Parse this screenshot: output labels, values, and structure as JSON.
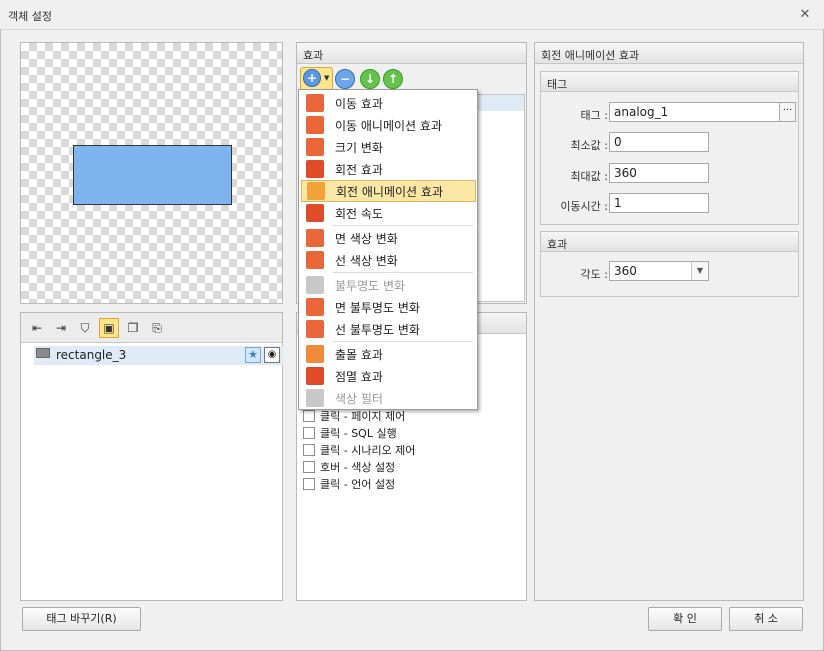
{
  "window": {
    "title": "객체 설정",
    "close_glyph": "✕"
  },
  "object_list": {
    "items": [
      {
        "name": "rectangle_3"
      }
    ]
  },
  "effect_panel": {
    "title": "효과"
  },
  "effect_menu": {
    "items": [
      {
        "label": "이동 효과",
        "icon": "move-effect-icon",
        "color": "#e8663a",
        "disabled": false
      },
      {
        "label": "이동 애니메이션 효과",
        "icon": "move-animation-icon",
        "color": "#e8663a",
        "disabled": false
      },
      {
        "label": "크기 변화",
        "icon": "resize-icon",
        "color": "#e8663a",
        "disabled": false
      },
      {
        "label": "회전 효과",
        "icon": "rotate-icon",
        "color": "#e04b2a",
        "disabled": false
      },
      {
        "label": "회전 애니메이션 효과",
        "icon": "rotate-animation-icon",
        "color": "#f3a13b",
        "disabled": false,
        "highlighted": true
      },
      {
        "label": "회전 속도",
        "icon": "rotate-speed-icon",
        "color": "#e04b2a",
        "disabled": false
      },
      {
        "label": "면 색상 변화",
        "icon": "fill-color-icon",
        "color": "#e8663a",
        "disabled": false
      },
      {
        "label": "선 색상 변화",
        "icon": "line-color-icon",
        "color": "#e8663a",
        "disabled": false
      },
      {
        "label": "불투명도 변화",
        "icon": "opacity-icon",
        "color": "#c8c8c8",
        "disabled": true
      },
      {
        "label": "면 불투명도 변화",
        "icon": "fill-opacity-icon",
        "color": "#e8663a",
        "disabled": false
      },
      {
        "label": "선 불투명도 변화",
        "icon": "line-opacity-icon",
        "color": "#e8663a",
        "disabled": false
      },
      {
        "label": "출몰 효과",
        "icon": "appear-icon",
        "color": "#f08a3b",
        "disabled": false
      },
      {
        "label": "점멸 효과",
        "icon": "blink-icon",
        "color": "#e04b2a",
        "disabled": false
      },
      {
        "label": "색상 필터",
        "icon": "color-filter-icon",
        "color": "#c8c8c8",
        "disabled": true
      }
    ]
  },
  "event_list": {
    "items": [
      {
        "label": "클릭 - 페이지 제어"
      },
      {
        "label": "클릭 - SQL 실행"
      },
      {
        "label": "클릭 - 시나리오 제어"
      },
      {
        "label": "호버 - 색상 설정"
      },
      {
        "label": "클릭 - 언어 설정"
      }
    ]
  },
  "anim_panel": {
    "title": "회전 애니메이션 효과",
    "tag_group": {
      "title": "태그",
      "tag_label": "태그 :",
      "tag_value": "analog_1",
      "min_label": "최소값 :",
      "min_value": "0",
      "max_label": "최대값 :",
      "max_value": "360",
      "time_label": "이동시간 :",
      "time_value": "1"
    },
    "effect_group": {
      "title": "효과",
      "angle_label": "각도 :",
      "angle_value": "360"
    }
  },
  "buttons": {
    "retag": "태그 바꾸기(R)",
    "ok": "확 인",
    "cancel": "취 소"
  }
}
